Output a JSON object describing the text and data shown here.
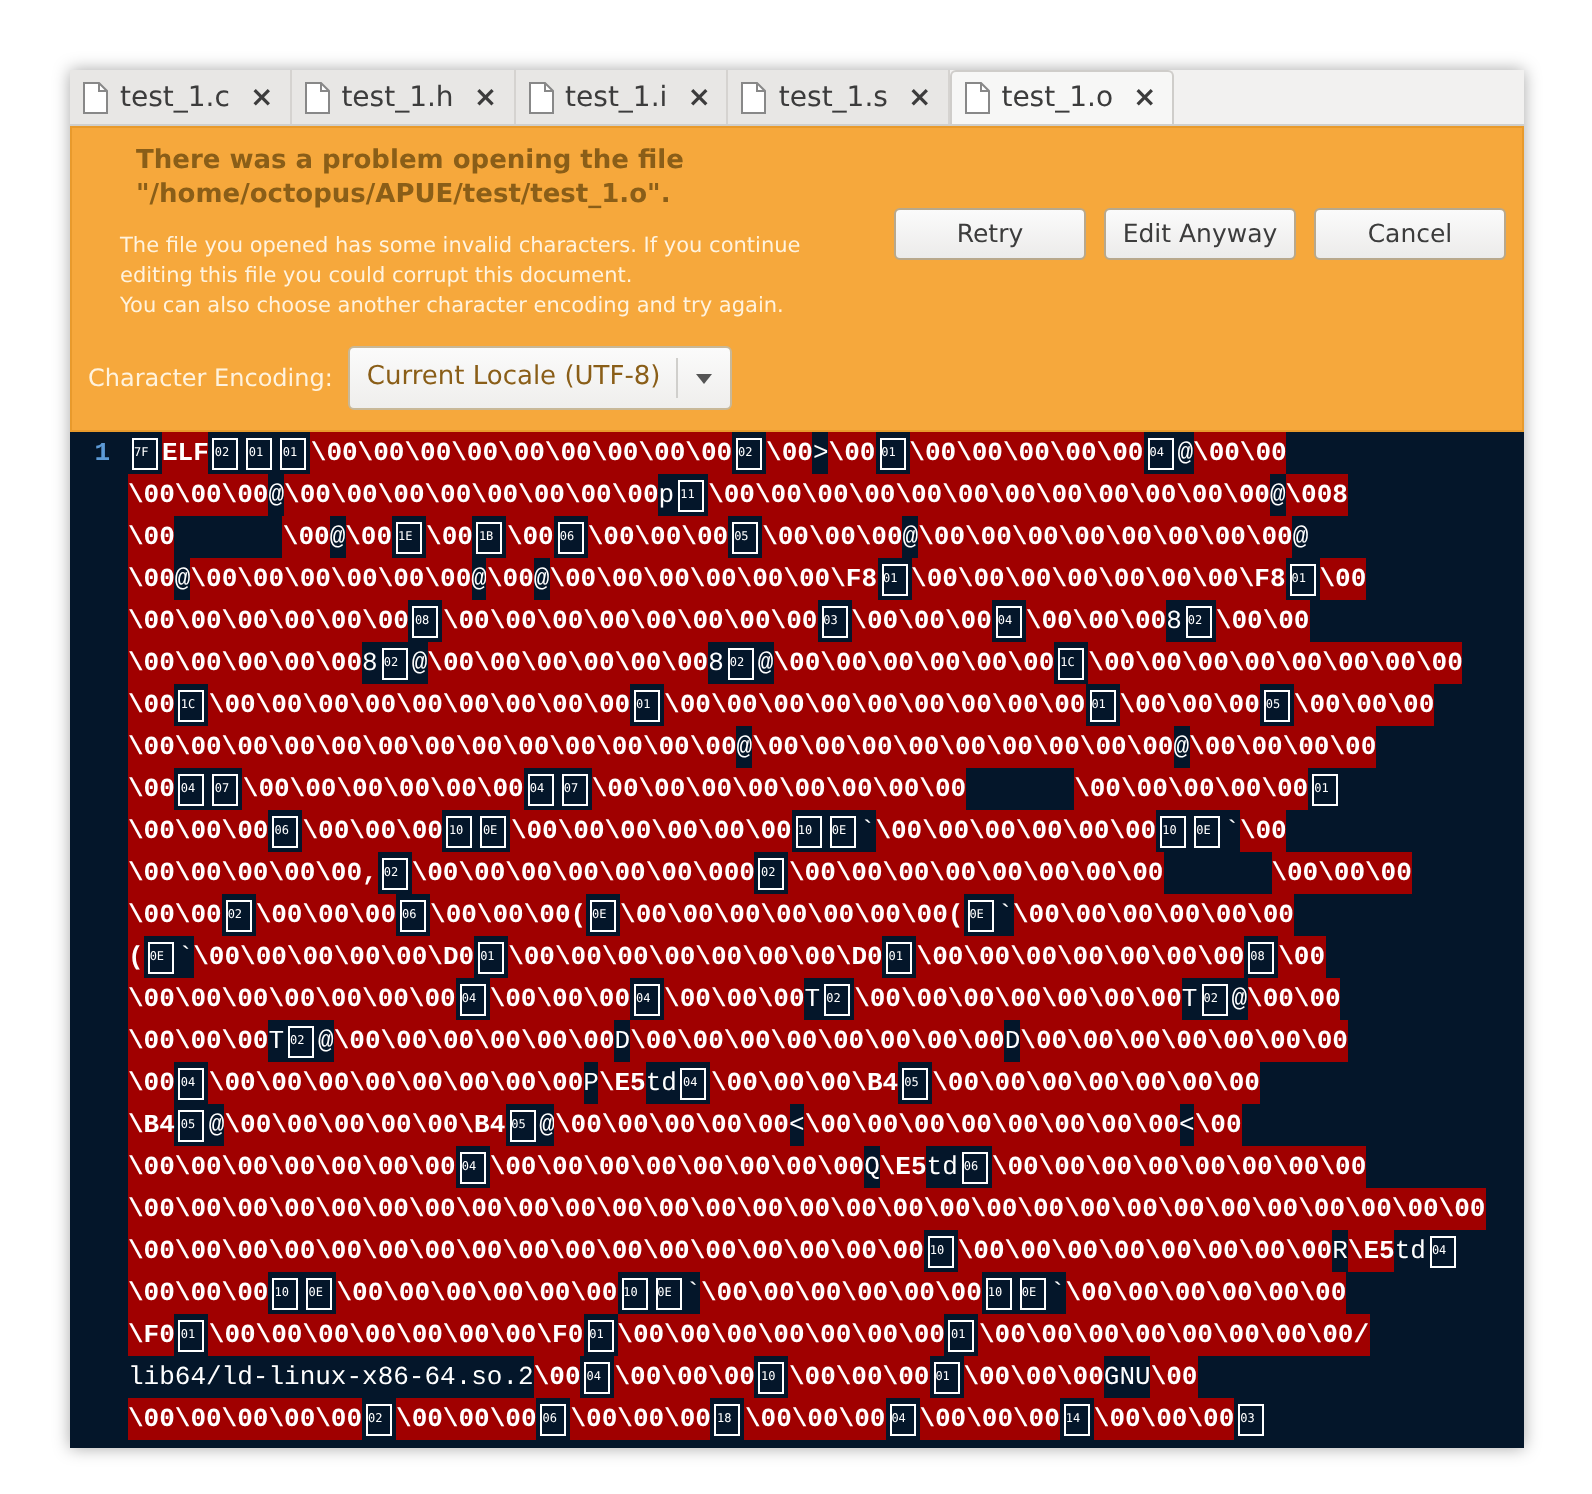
{
  "tabs": [
    {
      "label": "test_1.c",
      "close": "×",
      "selected": false
    },
    {
      "label": "test_1.h",
      "close": "×",
      "selected": false
    },
    {
      "label": "test_1.i",
      "close": "×",
      "selected": false
    },
    {
      "label": "test_1.s",
      "close": "×",
      "selected": false
    },
    {
      "label": "test_1.o",
      "close": "×",
      "selected": true
    }
  ],
  "info_bar": {
    "title": "There was a problem opening the file \"/home/octopus/APUE/test/test_1.o\".",
    "message": [
      "The file you opened has some invalid characters. If you continue",
      "editing this file you could corrupt this document.",
      "You can also choose another character encoding and try again."
    ],
    "buttons": [
      "Retry",
      "Edit Anyway",
      "Cancel"
    ],
    "encoding_label": "Character Encoding:",
    "encoding": "Current Locale (UTF-8)"
  },
  "editor": {
    "line_number": "1",
    "wrapped_lines": [
      [
        {
          "kind": "hex",
          "text": "7F"
        },
        {
          "kind": "esc",
          "text": "ELF"
        },
        {
          "kind": "hex",
          "text": "02"
        },
        {
          "kind": "hex",
          "text": "01"
        },
        {
          "kind": "hex",
          "text": "01"
        },
        {
          "kind": "esc",
          "text": "\\00\\00\\00\\00\\00\\00\\00\\00\\00"
        },
        {
          "kind": "hex",
          "text": "02"
        },
        {
          "kind": "esc",
          "text": "\\00"
        },
        {
          "kind": "char",
          "text": ">"
        },
        {
          "kind": "esc",
          "text": "\\00"
        },
        {
          "kind": "hex",
          "text": "01"
        },
        {
          "kind": "esc",
          "text": "\\00\\00\\00\\00\\00"
        },
        {
          "kind": "hex",
          "text": "04"
        },
        {
          "kind": "char",
          "text": "@"
        },
        {
          "kind": "esc",
          "text": "\\00\\00"
        }
      ],
      [
        {
          "kind": "esc",
          "text": "\\00\\00\\00"
        },
        {
          "kind": "char",
          "text": "@"
        },
        {
          "kind": "esc",
          "text": "\\00\\00\\00\\00\\00\\00\\00\\00"
        },
        {
          "kind": "char",
          "text": "p"
        },
        {
          "kind": "hex",
          "text": "11"
        },
        {
          "kind": "esc",
          "text": "\\00\\00\\00\\00\\00\\00\\00\\00\\00\\00\\00\\00"
        },
        {
          "kind": "char",
          "text": "@"
        },
        {
          "kind": "esc",
          "text": "\\008"
        }
      ],
      [
        {
          "kind": "esc",
          "text": "\\00"
        },
        {
          "kind": "tab"
        },
        {
          "kind": "esc",
          "text": "\\00"
        },
        {
          "kind": "char",
          "text": "@"
        },
        {
          "kind": "esc",
          "text": "\\00"
        },
        {
          "kind": "hex",
          "text": "1E"
        },
        {
          "kind": "esc",
          "text": "\\00"
        },
        {
          "kind": "hex",
          "text": "1B"
        },
        {
          "kind": "esc",
          "text": "\\00"
        },
        {
          "kind": "hex",
          "text": "06"
        },
        {
          "kind": "esc",
          "text": "\\00\\00\\00"
        },
        {
          "kind": "hex",
          "text": "05"
        },
        {
          "kind": "esc",
          "text": "\\00\\00\\00"
        },
        {
          "kind": "char",
          "text": "@"
        },
        {
          "kind": "esc",
          "text": "\\00\\00\\00\\00\\00\\00\\00\\00"
        },
        {
          "kind": "char",
          "text": "@"
        }
      ],
      [
        {
          "kind": "esc",
          "text": "\\00"
        },
        {
          "kind": "char",
          "text": "@"
        },
        {
          "kind": "esc",
          "text": "\\00\\00\\00\\00\\00\\00"
        },
        {
          "kind": "char",
          "text": "@"
        },
        {
          "kind": "esc",
          "text": "\\00"
        },
        {
          "kind": "char",
          "text": "@"
        },
        {
          "kind": "esc",
          "text": "\\00\\00\\00\\00\\00\\00\\F8"
        },
        {
          "kind": "hex",
          "text": "01"
        },
        {
          "kind": "esc",
          "text": "\\00\\00\\00\\00\\00\\00\\00\\F8"
        },
        {
          "kind": "hex",
          "text": "01"
        },
        {
          "kind": "esc",
          "text": "\\00"
        }
      ],
      [
        {
          "kind": "esc",
          "text": "\\00\\00\\00\\00\\00\\00"
        },
        {
          "kind": "hex",
          "text": "08"
        },
        {
          "kind": "esc",
          "text": "\\00\\00\\00\\00\\00\\00\\00\\00"
        },
        {
          "kind": "hex",
          "text": "03"
        },
        {
          "kind": "esc",
          "text": "\\00\\00\\00"
        },
        {
          "kind": "hex",
          "text": "04"
        },
        {
          "kind": "esc",
          "text": "\\00\\00\\00"
        },
        {
          "kind": "char",
          "text": "8"
        },
        {
          "kind": "hex",
          "text": "02"
        },
        {
          "kind": "esc",
          "text": "\\00\\00"
        }
      ],
      [
        {
          "kind": "esc",
          "text": "\\00\\00\\00\\00\\00"
        },
        {
          "kind": "char",
          "text": "8"
        },
        {
          "kind": "hex",
          "text": "02"
        },
        {
          "kind": "char",
          "text": "@"
        },
        {
          "kind": "esc",
          "text": "\\00\\00\\00\\00\\00\\00"
        },
        {
          "kind": "char",
          "text": "8"
        },
        {
          "kind": "hex",
          "text": "02"
        },
        {
          "kind": "char",
          "text": "@"
        },
        {
          "kind": "esc",
          "text": "\\00\\00\\00\\00\\00\\00"
        },
        {
          "kind": "hex",
          "text": "1C"
        },
        {
          "kind": "esc",
          "text": "\\00\\00\\00\\00\\00\\00\\00\\00"
        }
      ],
      [
        {
          "kind": "esc",
          "text": "\\00"
        },
        {
          "kind": "hex",
          "text": "1C"
        },
        {
          "kind": "esc",
          "text": "\\00\\00\\00\\00\\00\\00\\00\\00\\00"
        },
        {
          "kind": "hex",
          "text": "01"
        },
        {
          "kind": "esc",
          "text": "\\00\\00\\00\\00\\00\\00\\00\\00\\00"
        },
        {
          "kind": "hex",
          "text": "01"
        },
        {
          "kind": "esc",
          "text": "\\00\\00\\00"
        },
        {
          "kind": "hex",
          "text": "05"
        },
        {
          "kind": "esc",
          "text": "\\00\\00\\00"
        }
      ],
      [
        {
          "kind": "esc",
          "text": "\\00\\00\\00\\00\\00\\00\\00\\00\\00\\00\\00\\00\\00"
        },
        {
          "kind": "char",
          "text": "@"
        },
        {
          "kind": "esc",
          "text": "\\00\\00\\00\\00\\00\\00\\00\\00\\00"
        },
        {
          "kind": "char",
          "text": "@"
        },
        {
          "kind": "esc",
          "text": "\\00\\00\\00\\00"
        }
      ],
      [
        {
          "kind": "esc",
          "text": "\\00"
        },
        {
          "kind": "hex",
          "text": "04"
        },
        {
          "kind": "hex",
          "text": "07"
        },
        {
          "kind": "esc",
          "text": "\\00\\00\\00\\00\\00\\00"
        },
        {
          "kind": "hex",
          "text": "04"
        },
        {
          "kind": "hex",
          "text": "07"
        },
        {
          "kind": "esc",
          "text": "\\00\\00\\00\\00\\00\\00\\00\\00"
        },
        {
          "kind": "tab"
        },
        {
          "kind": "esc",
          "text": "\\00\\00\\00\\00\\00"
        },
        {
          "kind": "hex",
          "text": "01"
        }
      ],
      [
        {
          "kind": "esc",
          "text": "\\00\\00\\00"
        },
        {
          "kind": "hex",
          "text": "06"
        },
        {
          "kind": "esc",
          "text": "\\00\\00\\00"
        },
        {
          "kind": "hex",
          "text": "10"
        },
        {
          "kind": "hex",
          "text": "0E"
        },
        {
          "kind": "esc",
          "text": "\\00\\00\\00\\00\\00\\00"
        },
        {
          "kind": "hex",
          "text": "10"
        },
        {
          "kind": "hex",
          "text": "0E"
        },
        {
          "kind": "char",
          "text": "`"
        },
        {
          "kind": "esc",
          "text": "\\00\\00\\00\\00\\00\\00"
        },
        {
          "kind": "hex",
          "text": "10"
        },
        {
          "kind": "hex",
          "text": "0E"
        },
        {
          "kind": "char",
          "text": "`"
        },
        {
          "kind": "esc",
          "text": "\\00"
        }
      ],
      [
        {
          "kind": "esc",
          "text": "\\00\\00\\00\\00\\00,"
        },
        {
          "kind": "hex",
          "text": "02"
        },
        {
          "kind": "esc",
          "text": "\\00\\00\\00\\00\\00\\00\\000"
        },
        {
          "kind": "hex",
          "text": "02"
        },
        {
          "kind": "esc",
          "text": "\\00\\00\\00\\00\\00\\00\\00\\00"
        },
        {
          "kind": "tab"
        },
        {
          "kind": "esc",
          "text": "\\00\\00\\00"
        }
      ],
      [
        {
          "kind": "esc",
          "text": "\\00\\00"
        },
        {
          "kind": "hex",
          "text": "02"
        },
        {
          "kind": "esc",
          "text": "\\00\\00\\00"
        },
        {
          "kind": "hex",
          "text": "06"
        },
        {
          "kind": "esc",
          "text": "\\00\\00\\00("
        },
        {
          "kind": "hex",
          "text": "0E"
        },
        {
          "kind": "esc",
          "text": "\\00\\00\\00\\00\\00\\00\\00("
        },
        {
          "kind": "hex",
          "text": "0E"
        },
        {
          "kind": "char",
          "text": "`"
        },
        {
          "kind": "esc",
          "text": "\\00\\00\\00\\00\\00\\00"
        }
      ],
      [
        {
          "kind": "esc",
          "text": "("
        },
        {
          "kind": "hex",
          "text": "0E"
        },
        {
          "kind": "char",
          "text": "`"
        },
        {
          "kind": "esc",
          "text": "\\00\\00\\00\\00\\00\\D0"
        },
        {
          "kind": "hex",
          "text": "01"
        },
        {
          "kind": "esc",
          "text": "\\00\\00\\00\\00\\00\\00\\00\\D0"
        },
        {
          "kind": "hex",
          "text": "01"
        },
        {
          "kind": "esc",
          "text": "\\00\\00\\00\\00\\00\\00\\00"
        },
        {
          "kind": "hex",
          "text": "08"
        },
        {
          "kind": "esc",
          "text": "\\00"
        }
      ],
      [
        {
          "kind": "esc",
          "text": "\\00\\00\\00\\00\\00\\00\\00"
        },
        {
          "kind": "hex",
          "text": "04"
        },
        {
          "kind": "esc",
          "text": "\\00\\00\\00"
        },
        {
          "kind": "hex",
          "text": "04"
        },
        {
          "kind": "esc",
          "text": "\\00\\00\\00"
        },
        {
          "kind": "char",
          "text": "T"
        },
        {
          "kind": "hex",
          "text": "02"
        },
        {
          "kind": "esc",
          "text": "\\00\\00\\00\\00\\00\\00\\00"
        },
        {
          "kind": "char",
          "text": "T"
        },
        {
          "kind": "hex",
          "text": "02"
        },
        {
          "kind": "char",
          "text": "@"
        },
        {
          "kind": "esc",
          "text": "\\00\\00"
        }
      ],
      [
        {
          "kind": "esc",
          "text": "\\00\\00\\00"
        },
        {
          "kind": "char",
          "text": "T"
        },
        {
          "kind": "hex",
          "text": "02"
        },
        {
          "kind": "char",
          "text": "@"
        },
        {
          "kind": "esc",
          "text": "\\00\\00\\00\\00\\00\\00"
        },
        {
          "kind": "char",
          "text": "D"
        },
        {
          "kind": "esc",
          "text": "\\00\\00\\00\\00\\00\\00\\00\\00"
        },
        {
          "kind": "char",
          "text": "D"
        },
        {
          "kind": "esc",
          "text": "\\00\\00\\00\\00\\00\\00\\00"
        }
      ],
      [
        {
          "kind": "esc",
          "text": "\\00"
        },
        {
          "kind": "hex",
          "text": "04"
        },
        {
          "kind": "esc",
          "text": "\\00\\00\\00\\00\\00\\00\\00\\00"
        },
        {
          "kind": "char",
          "text": "P"
        },
        {
          "kind": "esc",
          "text": "\\E5"
        },
        {
          "kind": "char",
          "text": "td"
        },
        {
          "kind": "hex",
          "text": "04"
        },
        {
          "kind": "esc",
          "text": "\\00\\00\\00\\B4"
        },
        {
          "kind": "hex",
          "text": "05"
        },
        {
          "kind": "esc",
          "text": "\\00\\00\\00\\00\\00\\00\\00"
        }
      ],
      [
        {
          "kind": "esc",
          "text": "\\B4"
        },
        {
          "kind": "hex",
          "text": "05"
        },
        {
          "kind": "char",
          "text": "@"
        },
        {
          "kind": "esc",
          "text": "\\00\\00\\00\\00\\00\\B4"
        },
        {
          "kind": "hex",
          "text": "05"
        },
        {
          "kind": "char",
          "text": "@"
        },
        {
          "kind": "esc",
          "text": "\\00\\00\\00\\00\\00"
        },
        {
          "kind": "char",
          "text": "<"
        },
        {
          "kind": "esc",
          "text": "\\00\\00\\00\\00\\00\\00\\00\\00"
        },
        {
          "kind": "char",
          "text": "<"
        },
        {
          "kind": "esc",
          "text": "\\00"
        }
      ],
      [
        {
          "kind": "esc",
          "text": "\\00\\00\\00\\00\\00\\00\\00"
        },
        {
          "kind": "hex",
          "text": "04"
        },
        {
          "kind": "esc",
          "text": "\\00\\00\\00\\00\\00\\00\\00\\00"
        },
        {
          "kind": "char",
          "text": "Q"
        },
        {
          "kind": "esc",
          "text": "\\E5"
        },
        {
          "kind": "char",
          "text": "td"
        },
        {
          "kind": "hex",
          "text": "06"
        },
        {
          "kind": "esc",
          "text": "\\00\\00\\00\\00\\00\\00\\00\\00"
        }
      ],
      [
        {
          "kind": "esc",
          "text": "\\00\\00\\00\\00\\00\\00\\00\\00\\00\\00\\00\\00\\00\\00\\00\\00\\00\\00\\00\\00\\00\\00\\00\\00\\00\\00\\00\\00\\00"
        }
      ],
      [
        {
          "kind": "esc",
          "text": "\\00\\00\\00\\00\\00\\00\\00\\00\\00\\00\\00\\00\\00\\00\\00\\00\\00"
        },
        {
          "kind": "hex",
          "text": "10"
        },
        {
          "kind": "esc",
          "text": "\\00\\00\\00\\00\\00\\00\\00\\00"
        },
        {
          "kind": "char",
          "text": "R"
        },
        {
          "kind": "esc",
          "text": "\\E5"
        },
        {
          "kind": "char",
          "text": "td"
        },
        {
          "kind": "hex",
          "text": "04"
        }
      ],
      [
        {
          "kind": "esc",
          "text": "\\00\\00\\00"
        },
        {
          "kind": "hex",
          "text": "10"
        },
        {
          "kind": "hex",
          "text": "0E"
        },
        {
          "kind": "esc",
          "text": "\\00\\00\\00\\00\\00\\00"
        },
        {
          "kind": "hex",
          "text": "10"
        },
        {
          "kind": "hex",
          "text": "0E"
        },
        {
          "kind": "char",
          "text": "`"
        },
        {
          "kind": "esc",
          "text": "\\00\\00\\00\\00\\00\\00"
        },
        {
          "kind": "hex",
          "text": "10"
        },
        {
          "kind": "hex",
          "text": "0E"
        },
        {
          "kind": "char",
          "text": "`"
        },
        {
          "kind": "esc",
          "text": "\\00\\00\\00\\00\\00\\00"
        }
      ],
      [
        {
          "kind": "esc",
          "text": "\\F0"
        },
        {
          "kind": "hex",
          "text": "01"
        },
        {
          "kind": "esc",
          "text": "\\00\\00\\00\\00\\00\\00\\00\\F0"
        },
        {
          "kind": "hex",
          "text": "01"
        },
        {
          "kind": "esc",
          "text": "\\00\\00\\00\\00\\00\\00\\00"
        },
        {
          "kind": "hex",
          "text": "01"
        },
        {
          "kind": "esc",
          "text": "\\00\\00\\00\\00\\00\\00\\00\\00/"
        }
      ],
      [
        {
          "kind": "char",
          "text": "lib64/ld-linux-x86-64.so.2"
        },
        {
          "kind": "esc",
          "text": "\\00"
        },
        {
          "kind": "hex",
          "text": "04"
        },
        {
          "kind": "esc",
          "text": "\\00\\00\\00"
        },
        {
          "kind": "hex",
          "text": "10"
        },
        {
          "kind": "esc",
          "text": "\\00\\00\\00"
        },
        {
          "kind": "hex",
          "text": "01"
        },
        {
          "kind": "esc",
          "text": "\\00\\00\\00"
        },
        {
          "kind": "char",
          "text": "GNU"
        },
        {
          "kind": "esc",
          "text": "\\00"
        }
      ],
      [
        {
          "kind": "esc",
          "text": "\\00\\00\\00\\00\\00"
        },
        {
          "kind": "hex",
          "text": "02"
        },
        {
          "kind": "esc",
          "text": "\\00\\00\\00"
        },
        {
          "kind": "hex",
          "text": "06"
        },
        {
          "kind": "esc",
          "text": "\\00\\00\\00"
        },
        {
          "kind": "hex",
          "text": "18"
        },
        {
          "kind": "esc",
          "text": "\\00\\00\\00"
        },
        {
          "kind": "hex",
          "text": "04"
        },
        {
          "kind": "esc",
          "text": "\\00\\00\\00"
        },
        {
          "kind": "hex",
          "text": "14"
        },
        {
          "kind": "esc",
          "text": "\\00\\00\\00"
        },
        {
          "kind": "hex",
          "text": "03"
        }
      ]
    ]
  }
}
